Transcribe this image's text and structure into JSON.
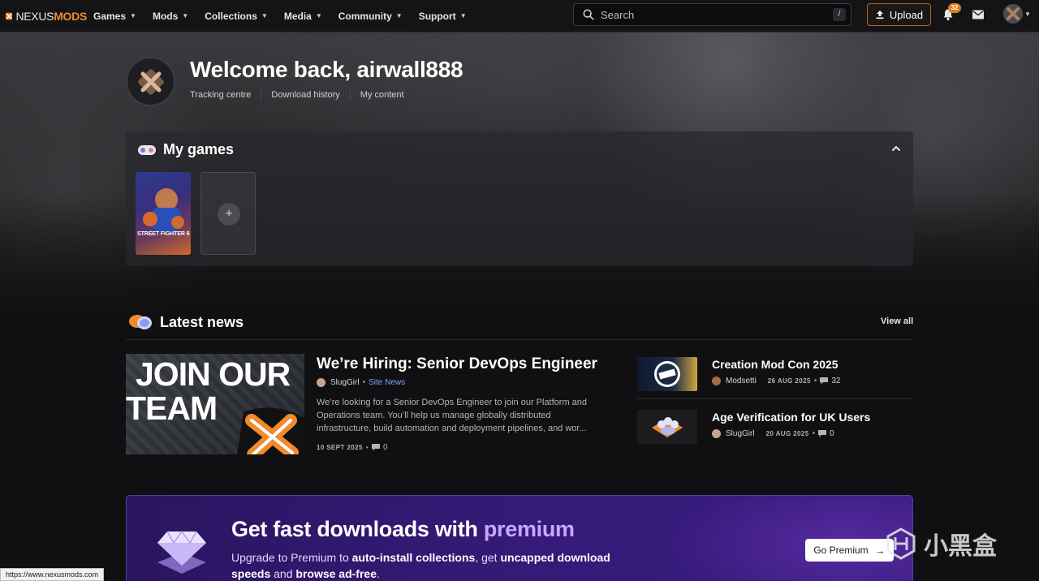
{
  "brand": {
    "name_light": "NEXUS",
    "name_bold": "MODS"
  },
  "nav": {
    "items": [
      {
        "label": "Games"
      },
      {
        "label": "Mods"
      },
      {
        "label": "Collections"
      },
      {
        "label": "Media"
      },
      {
        "label": "Community"
      },
      {
        "label": "Support"
      }
    ]
  },
  "search": {
    "placeholder": "Search",
    "shortcut": "/"
  },
  "header_actions": {
    "upload_label": "Upload",
    "notification_count": "32"
  },
  "welcome": {
    "title": "Welcome back, airwall888",
    "links": [
      "Tracking centre",
      "Download history",
      "My content"
    ]
  },
  "my_games": {
    "title": "My games",
    "games": [
      {
        "label": "STREET FIGHTER 6"
      }
    ],
    "add_symbol": "+"
  },
  "news": {
    "title": "Latest news",
    "view_all": "View all",
    "featured": {
      "image_text_1": "JOIN OUR",
      "image_text_2": "TEAM",
      "title": "We’re Hiring: Senior DevOps Engineer",
      "author": "SlugGirl",
      "category": "Site News",
      "description": "We’re looking for a Senior DevOps Engineer to join our Platform and Operations team. You’ll help us manage globally distributed infrastructure, build automation and deployment pipelines, and wor...",
      "date": "10 SEPT 2025",
      "comments": "0"
    },
    "side": [
      {
        "title": "Creation Mod Con 2025",
        "author": "Modsetti",
        "date": "26 AUG 2025",
        "comments": "32"
      },
      {
        "title": "Age Verification for UK Users",
        "author": "SlugGirl",
        "date": "20 AUG 2025",
        "comments": "0"
      }
    ]
  },
  "premium": {
    "title_main": "Get fast downloads with ",
    "title_highlight": "premium",
    "sub_1": "Upgrade to Premium to ",
    "sub_2": "auto-install collections",
    "sub_3": ", get ",
    "sub_4": "uncapped download speeds",
    "sub_5": " and ",
    "sub_6": "browse ad-free",
    "sub_7": ".",
    "button": "Go Premium"
  },
  "status_bar": {
    "url": "https://www.nexusmods.com"
  },
  "watermark": {
    "text": "小黑盒"
  },
  "colors": {
    "accent": "#f08a2a",
    "premium": "#351a78",
    "link": "#7ea8f2"
  }
}
